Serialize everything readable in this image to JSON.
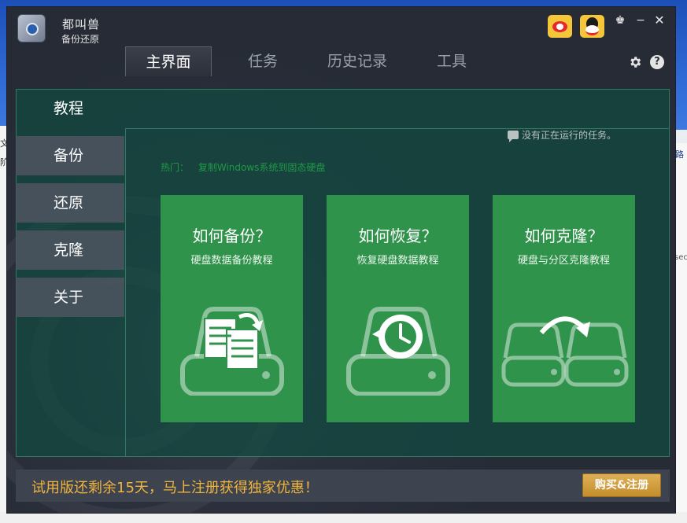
{
  "app": {
    "brand_script": "都叫兽",
    "brand_name": "备份还原",
    "social": [
      "weibo-icon",
      "qq-icon"
    ]
  },
  "window_controls": {
    "skin": "♚",
    "minimize": "−",
    "close": "✕"
  },
  "tabs": [
    {
      "label": "主界面",
      "active": true
    },
    {
      "label": "任务",
      "active": false
    },
    {
      "label": "历史记录",
      "active": false
    },
    {
      "label": "工具",
      "active": false
    }
  ],
  "toolbar": {
    "help": "?"
  },
  "nav": [
    {
      "label": "教程",
      "active": true
    },
    {
      "label": "备份",
      "active": false
    },
    {
      "label": "还原",
      "active": false
    },
    {
      "label": "克隆",
      "active": false
    },
    {
      "label": "关于",
      "active": false
    }
  ],
  "status": {
    "text": "没有正在运行的任务。"
  },
  "hot": {
    "label": "热门：",
    "link": "复制Windows系统到固态硬盘"
  },
  "cards": [
    {
      "title": "如何备份？",
      "subtitle": "硬盘数据备份教程",
      "icon": "backup-drive-icon"
    },
    {
      "title": "如何恢复？",
      "subtitle": "恢复硬盘数据教程",
      "icon": "restore-drive-icon"
    },
    {
      "title": "如何克隆？",
      "subtitle": "硬盘与分区克隆教程",
      "icon": "clone-drives-icon"
    }
  ],
  "footer": {
    "promo": "试用版还剩余15天，马上注册获得独家优惠！",
    "buy_label": "购买&注册"
  },
  "desktop": {
    "left_fragment_1": "文",
    "left_fragment_2": "阶",
    "right_fragment_1": "路",
    "right_fragment_2": "sec"
  },
  "colors": {
    "accent_green": "#2f934b",
    "panel_teal": "#104a40",
    "promo_gold": "#f0b53c",
    "buy_gold": "#d19d3f"
  }
}
